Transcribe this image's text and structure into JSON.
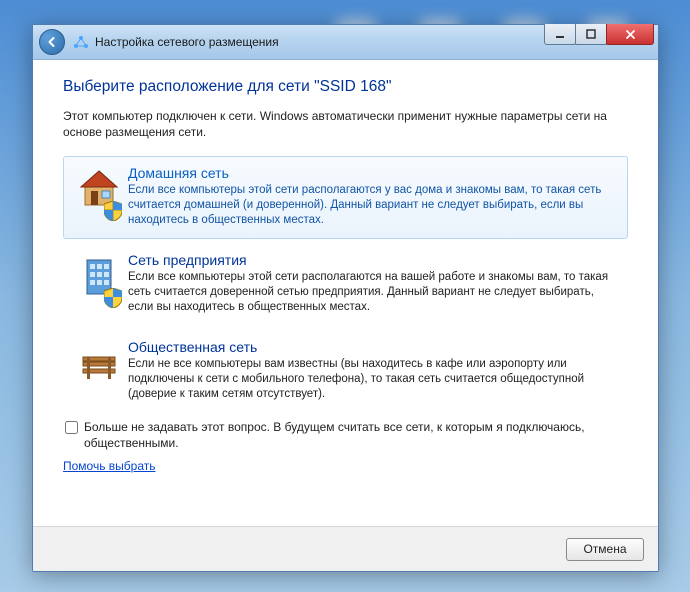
{
  "window": {
    "title": "Настройка сетевого размещения"
  },
  "page": {
    "heading": "Выберите расположение для сети \"SSID  168\"",
    "intro": "Этот компьютер подключен к сети. Windows автоматически применит нужные параметры сети на основе размещения сети."
  },
  "options": {
    "home": {
      "title": "Домашняя сеть",
      "desc": "Если все компьютеры этой сети располагаются у вас дома и знакомы вам, то такая сеть считается домашней (и доверенной). Данный вариант не следует выбирать, если вы находитесь в общественных местах."
    },
    "work": {
      "title": "Сеть предприятия",
      "desc": "Если все компьютеры этой сети располагаются на вашей работе и знакомы вам, то такая сеть считается доверенной сетью предприятия. Данный вариант не следует выбирать, если вы находитесь в общественных местах."
    },
    "public": {
      "title": "Общественная сеть",
      "desc": "Если не все компьютеры вам известны (вы находитесь в кафе или аэропорту или подключены к сети с мобильного телефона), то такая сеть считается общедоступной (доверие к таким сетям отсутствует)."
    }
  },
  "dont_ask": "Больше не задавать этот вопрос. В будущем считать все сети, к которым я подключаюсь, общественными.",
  "help_link": "Помочь выбрать",
  "footer": {
    "cancel": "Отмена"
  }
}
